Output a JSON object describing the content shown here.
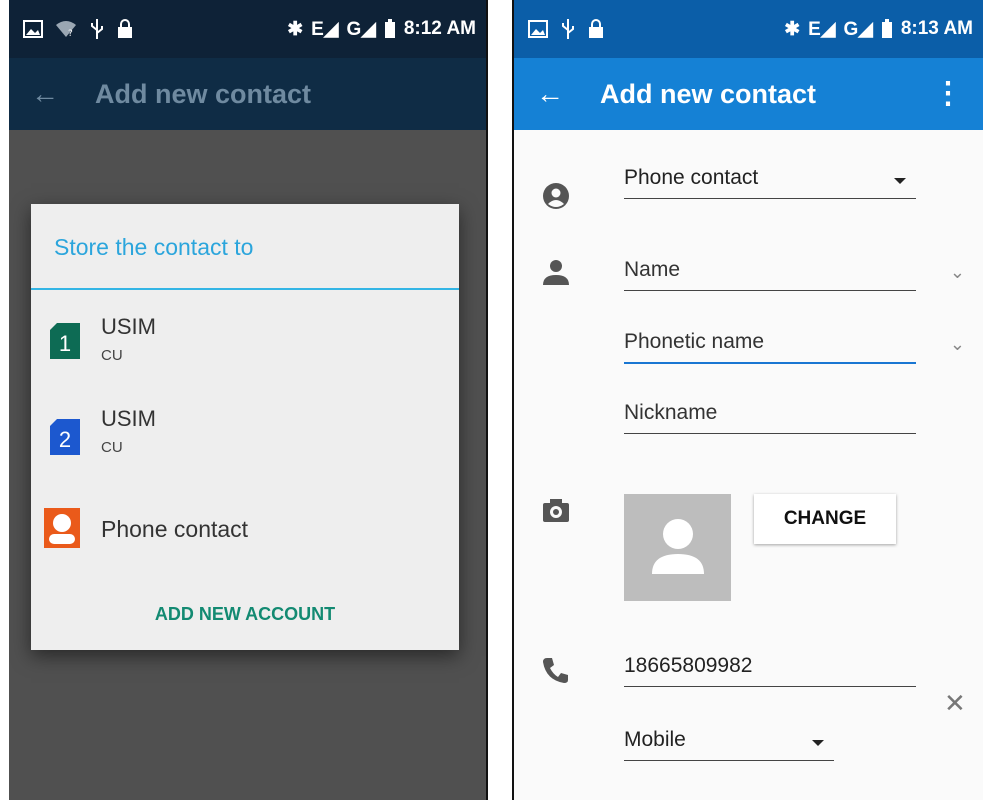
{
  "left_screen": {
    "status_time": "8:12 AM",
    "status_icons": [
      "image-icon",
      "wifi-question-icon",
      "usb-icon",
      "lock-icon",
      "bluetooth-icon",
      "signal-e-icon",
      "signal-g-icon",
      "battery-icon"
    ],
    "app_title": "Add new contact",
    "dialog": {
      "title": "Store the contact to",
      "options": [
        {
          "label": "USIM",
          "sub": "CU",
          "icon": "sim-1-icon",
          "badge": "1",
          "color": "#0d6b54"
        },
        {
          "label": "USIM",
          "sub": "CU",
          "icon": "sim-2-icon",
          "badge": "2",
          "color": "#1c58cf"
        },
        {
          "label": "Phone contact",
          "sub": "",
          "icon": "phone-contact-icon",
          "color": "#ea5a1a"
        }
      ],
      "action": "ADD NEW ACCOUNT"
    }
  },
  "right_screen": {
    "status_time": "8:13 AM",
    "app_title": "Add new contact",
    "account": {
      "value": "Phone contact"
    },
    "name": {
      "placeholder": "Name"
    },
    "phonetic": {
      "placeholder": "Phonetic name"
    },
    "nickname": {
      "placeholder": "Nickname"
    },
    "photo": {
      "button_label": "CHANGE"
    },
    "phone": {
      "value": "18665809982",
      "type": "Mobile"
    }
  },
  "colors": {
    "left_appbar": "#0f2c45",
    "right_appbar": "#1581d5",
    "dialog_accent": "#33b5e5",
    "action_teal": "#138a72"
  }
}
